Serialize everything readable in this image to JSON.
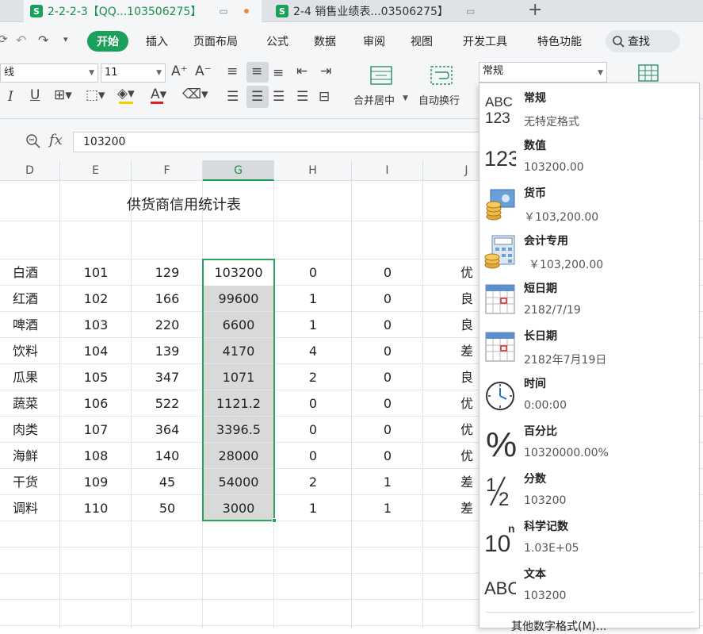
{
  "tabs": [
    {
      "badge": "S",
      "label": "2-2-2-3【QQ...103506275】"
    },
    {
      "badge": "S",
      "label": "2-4 销售业绩表...03506275】"
    }
  ],
  "new_tab": "+",
  "menu": {
    "items": [
      "开始",
      "插入",
      "页面布局",
      "公式",
      "数据",
      "审阅",
      "视图",
      "开发工具",
      "特色功能"
    ],
    "search_label": "查找"
  },
  "ribbon": {
    "font_name": "线",
    "font_size": "11",
    "merge_label": "合并居中",
    "wrap_label": "自动换行",
    "number_format": "常规"
  },
  "formula_bar": {
    "value": "103200"
  },
  "columns": [
    "D",
    "E",
    "F",
    "G",
    "H",
    "I",
    "J"
  ],
  "sheet_title": "供货商信用统计表",
  "rows": [
    {
      "d": "白酒",
      "e": "101",
      "f": "129",
      "g": "103200",
      "h": "0",
      "i": "0",
      "j": "优"
    },
    {
      "d": "红酒",
      "e": "102",
      "f": "166",
      "g": "99600",
      "h": "1",
      "i": "0",
      "j": "良"
    },
    {
      "d": "啤酒",
      "e": "103",
      "f": "220",
      "g": "6600",
      "h": "1",
      "i": "0",
      "j": "良"
    },
    {
      "d": "饮料",
      "e": "104",
      "f": "139",
      "g": "4170",
      "h": "4",
      "i": "0",
      "j": "差"
    },
    {
      "d": "瓜果",
      "e": "105",
      "f": "347",
      "g": "1071",
      "h": "2",
      "i": "0",
      "j": "良"
    },
    {
      "d": "蔬菜",
      "e": "106",
      "f": "522",
      "g": "1121.2",
      "h": "0",
      "i": "0",
      "j": "优"
    },
    {
      "d": "肉类",
      "e": "107",
      "f": "364",
      "g": "3396.5",
      "h": "0",
      "i": "0",
      "j": "优"
    },
    {
      "d": "海鲜",
      "e": "108",
      "f": "140",
      "g": "28000",
      "h": "0",
      "i": "0",
      "j": "优"
    },
    {
      "d": "干货",
      "e": "109",
      "f": "45",
      "g": "54000",
      "h": "2",
      "i": "1",
      "j": "差"
    },
    {
      "d": "调料",
      "e": "110",
      "f": "50",
      "g": "3000",
      "h": "1",
      "i": "1",
      "j": "差"
    }
  ],
  "format_menu": {
    "options": [
      {
        "icon": "abc-123-icon",
        "title": "常规",
        "example": "无特定格式"
      },
      {
        "icon": "number-123-icon",
        "title": "数值",
        "example": "103200.00"
      },
      {
        "icon": "currency-coins-icon",
        "title": "货币",
        "example": "￥103,200.00"
      },
      {
        "icon": "accounting-calculator-icon",
        "title": "会计专用",
        "example": "￥103,200.00"
      },
      {
        "icon": "short-date-calendar-icon",
        "title": "短日期",
        "example": "2182/7/19"
      },
      {
        "icon": "long-date-calendar-icon",
        "title": "长日期",
        "example": "2182年7月19日"
      },
      {
        "icon": "clock-icon",
        "title": "时间",
        "example": "0:00:00"
      },
      {
        "icon": "percent-icon",
        "title": "百分比",
        "example": "10320000.00%"
      },
      {
        "icon": "fraction-icon",
        "title": "分数",
        "example": "103200"
      },
      {
        "icon": "scientific-icon",
        "title": "科学记数",
        "example": "1.03E+05"
      },
      {
        "icon": "text-abc-icon",
        "title": "文本",
        "example": "103200"
      }
    ],
    "more_label": "其他数字格式(M)..."
  },
  "colors": {
    "accent": "#1aa05a",
    "selection_border": "#2aa65a",
    "selected_fill": "#d9d9d9"
  }
}
